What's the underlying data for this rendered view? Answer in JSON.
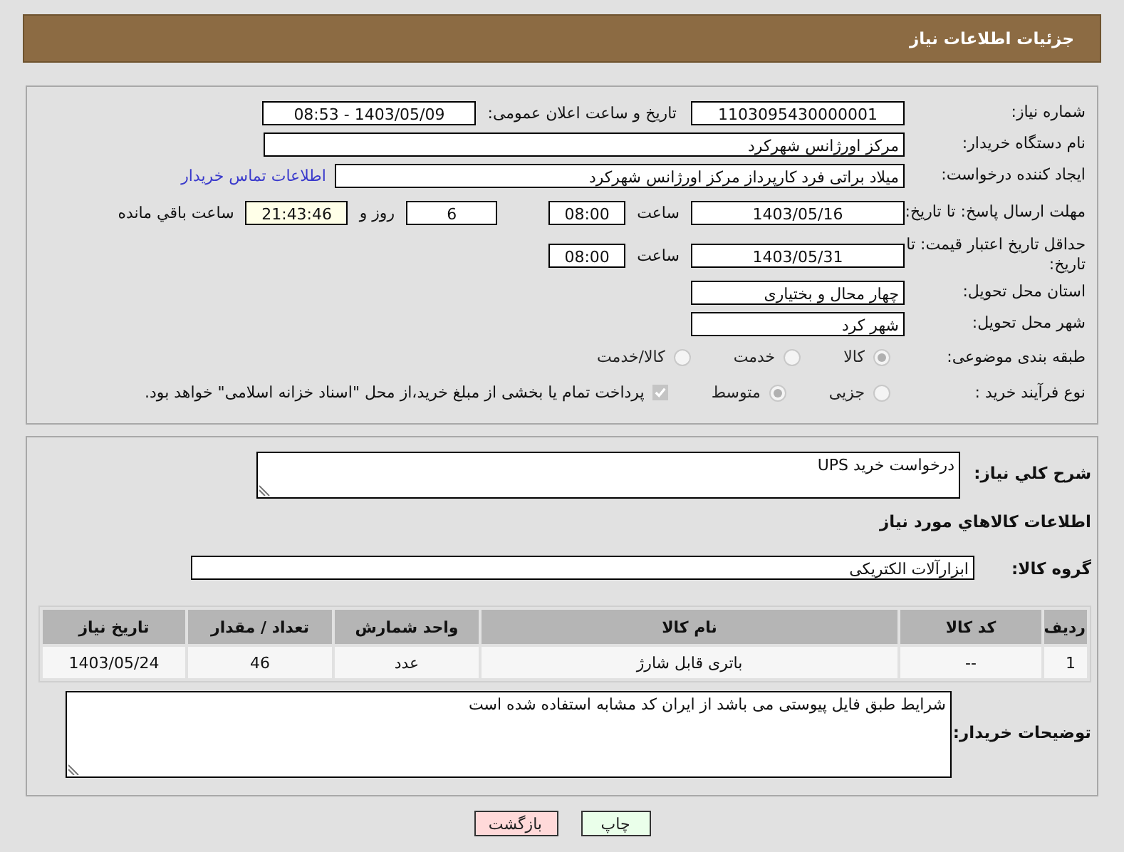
{
  "header": {
    "title": "جزئیات اطلاعات نیاز"
  },
  "need_number": {
    "label": "شماره نیاز:",
    "value": "1103095430000001"
  },
  "announce": {
    "label": "تاریخ و ساعت اعلان عمومی:",
    "value": "1403/05/09 - 08:53"
  },
  "buyer_org": {
    "label": "نام دستگاه خریدار:",
    "value": "مرکز اورژانس شهرکرد"
  },
  "requester": {
    "label": "ایجاد کننده درخواست:",
    "value": "میلاد براتی فرد کارپرداز مرکز اورژانس شهرکرد",
    "contact_link": "اطلاعات تماس خریدار"
  },
  "reply_deadline": {
    "label": "مهلت ارسال پاسخ: تا تاریخ:",
    "date": "1403/05/16",
    "time_label": "ساعت",
    "time": "08:00",
    "days": "6",
    "days_suffix": "روز و",
    "remaining": "21:43:46",
    "remaining_label": "ساعت باقي مانده"
  },
  "price_validity": {
    "label": "حداقل تاریخ اعتبار قیمت: تا تاریخ:",
    "date": "1403/05/31",
    "time_label": "ساعت",
    "time": "08:00"
  },
  "province": {
    "label": "استان محل تحویل:",
    "value": "چهار محال و بختیاری"
  },
  "city": {
    "label": "شهر محل تحویل:",
    "value": "شهر کرد"
  },
  "category": {
    "label": "طبقه بندی موضوعی:",
    "options": [
      {
        "label": "کالا",
        "selected": true
      },
      {
        "label": "خدمت",
        "selected": false
      },
      {
        "label": "کالا/خدمت",
        "selected": false
      }
    ]
  },
  "purchase_type": {
    "label": "نوع فرآیند خرید :",
    "options": [
      {
        "label": "جزیی",
        "selected": false
      },
      {
        "label": "متوسط",
        "selected": true
      }
    ],
    "payment": {
      "checked": true,
      "text": "پرداخت تمام یا بخشی از مبلغ خرید،از محل \"اسناد خزانه اسلامی\" خواهد بود."
    }
  },
  "description": {
    "label": "شرح کلي نياز:",
    "value": "درخواست خرید UPS"
  },
  "goods_heading": "اطلاعات کالاهاي مورد نياز",
  "goods_group": {
    "label": "گروه کالا:",
    "value": "ابزارآلات الکتریکی"
  },
  "table": {
    "columns": [
      "ردیف",
      "کد کالا",
      "نام کالا",
      "واحد شمارش",
      "تعداد / مقدار",
      "تاریخ نیاز"
    ],
    "rows": [
      [
        "1",
        "--",
        "باتری قابل شارژ",
        "عدد",
        "46",
        "1403/05/24"
      ]
    ]
  },
  "buyer_notes": {
    "label": "توضیحات خریدار:",
    "value": "شرایط طبق فایل پیوستی می باشد از ایران کد مشابه استفاده شده است"
  },
  "buttons": [
    {
      "label": "چاپ",
      "kind": "print"
    },
    {
      "label": "بازگشت",
      "kind": "back"
    }
  ]
}
